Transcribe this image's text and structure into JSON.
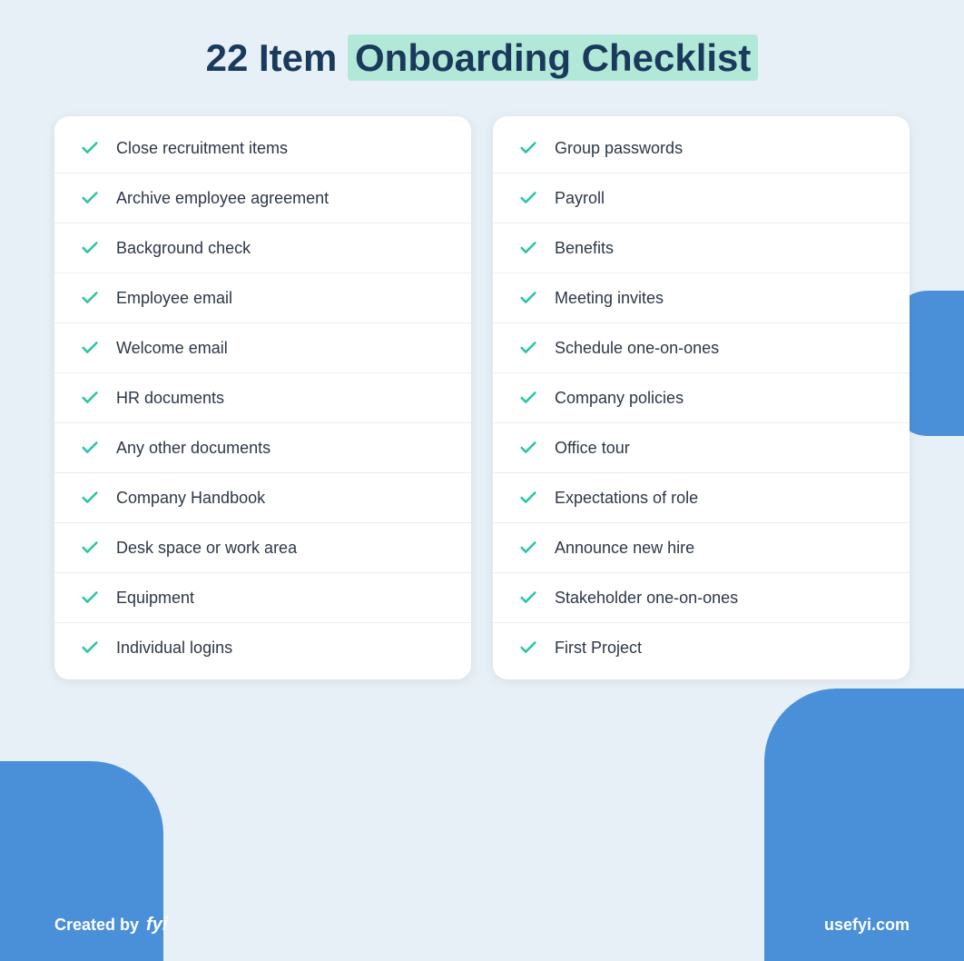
{
  "title": {
    "prefix": "22 Item ",
    "highlight": "Onboarding Checklist"
  },
  "left_items": [
    "Close recruitment items",
    "Archive employee agreement",
    "Background check",
    "Employee email",
    "Welcome email",
    "HR documents",
    "Any other documents",
    "Company Handbook",
    "Desk space or work area",
    "Equipment",
    "Individual logins"
  ],
  "right_items": [
    "Group passwords",
    "Payroll",
    "Benefits",
    "Meeting invites",
    "Schedule one-on-ones",
    "Company policies",
    "Office tour",
    "Expectations of role",
    "Announce new hire",
    "Stakeholder one-on-ones",
    "First Project"
  ],
  "footer": {
    "created_by_label": "Created by",
    "brand": "fyi",
    "url": "usefyi.com"
  }
}
